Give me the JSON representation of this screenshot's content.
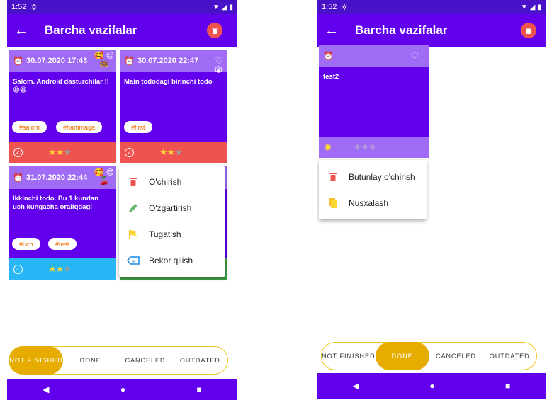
{
  "colors": {
    "primary": "#6200ee",
    "primary_light": "#a16cf5",
    "danger": "#ef5350",
    "accent": "#e6ad00",
    "done": "#29b6f6"
  },
  "left": {
    "status": {
      "time": "1:52"
    },
    "appbar": {
      "title": "Barcha vazifalar"
    },
    "cards": [
      {
        "date": "30.07.2020 17:43",
        "text": "Salom. Android dasturchilar !! 😀😀",
        "tags": [
          "#salom",
          "#hammaga"
        ],
        "stars": 2,
        "emojis": "🥰 😥 🍩"
      },
      {
        "date": "30.07.2020 22:47",
        "text": "Main tododagi birinchi todo",
        "tags": [
          "#first"
        ],
        "stars": 2,
        "emojis": "😭"
      },
      {
        "date": "31.07.2020 22:44",
        "text": "Ikkinchi todo. Bu 1 kundan uch kungacha oraliqdagi",
        "tags": [
          "#uch",
          "#test"
        ],
        "stars": 2,
        "emojis": "🥰 😎 🍒"
      }
    ],
    "popup": [
      "O'chirish",
      "O'zgartirish",
      "Tugatish",
      "Bekor qilish"
    ],
    "filter": [
      "NOT FINISHED",
      "DONE",
      "CANCELED",
      "OUTDATED"
    ],
    "active_filter": "NOT FINISHED"
  },
  "right": {
    "status": {
      "time": "1:52"
    },
    "appbar": {
      "title": "Barcha vazifalar"
    },
    "card": {
      "text": "test2",
      "stars": 0
    },
    "popup": [
      "Butunlay o'chirish",
      "Nusxalash"
    ],
    "filter": [
      "NOT FINISHED",
      "DONE",
      "CANCELED",
      "OUTDATED"
    ],
    "active_filter": "DONE"
  }
}
